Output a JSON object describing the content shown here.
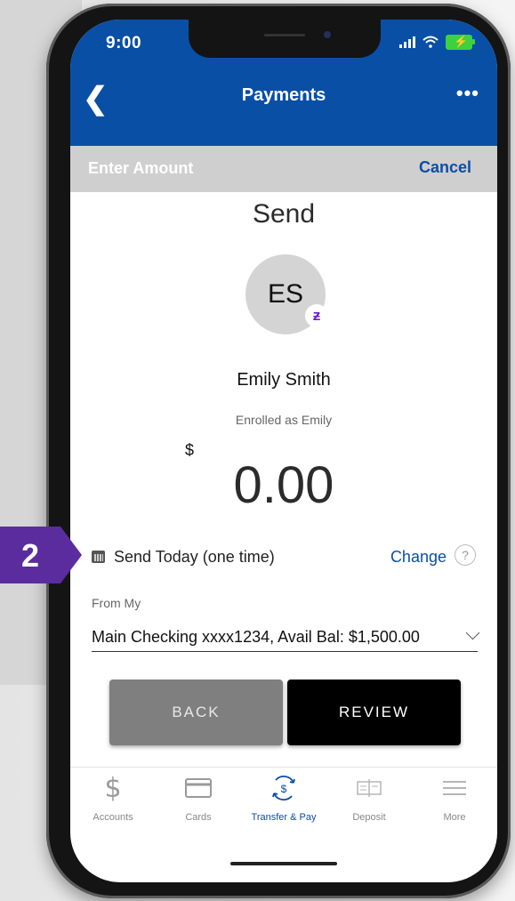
{
  "status_bar": {
    "time": "9:00"
  },
  "nav": {
    "back_icon": "chevron-left-icon",
    "title": "Payments",
    "more_label": "•••"
  },
  "subheader": {
    "title": "Enter Amount",
    "cancel_label": "Cancel"
  },
  "send": {
    "title": "Send",
    "avatar_initials": "ES",
    "badge_glyph": "ƶ",
    "recipient_name": "Emily Smith",
    "recipient_sub": "Enrolled as Emily",
    "currency_symbol": "$",
    "amount": "0.00"
  },
  "schedule": {
    "text": "Send Today (one time)",
    "change_label": "Change",
    "help_glyph": "?"
  },
  "from": {
    "label": "From My",
    "account": "Main Checking xxxx1234, Avail Bal: $1,500.00"
  },
  "buttons": {
    "back": "BACK",
    "review": "REVIEW"
  },
  "tabs": [
    {
      "label": "Accounts",
      "icon": "dollar-icon"
    },
    {
      "label": "Cards",
      "icon": "card-icon"
    },
    {
      "label": "Transfer & Pay",
      "icon": "transfer-pay-icon",
      "active": true
    },
    {
      "label": "Deposit",
      "icon": "check-deposit-icon"
    },
    {
      "label": "More",
      "icon": "menu-icon"
    }
  ],
  "callout": {
    "number": "2"
  },
  "colors": {
    "brand_blue": "#0a4fa6",
    "callout_purple": "#5b2c9e",
    "subheader_gray": "#cfcfcf"
  }
}
